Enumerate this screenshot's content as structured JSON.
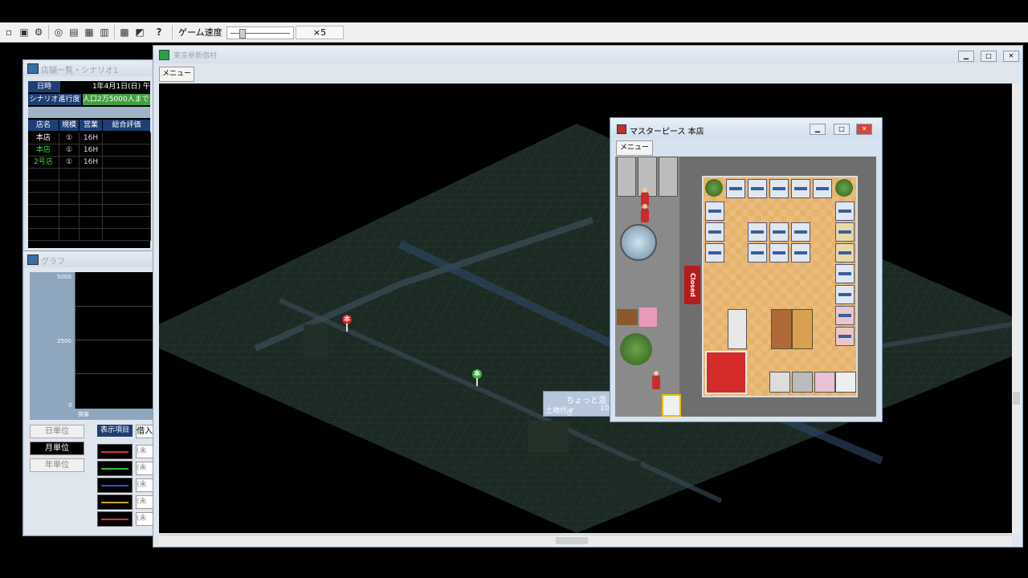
{
  "toolbar": {
    "icons": [
      "new-icon",
      "save-icon",
      "settings-icon",
      "search-icon",
      "print-icon",
      "list-icon",
      "book-icon",
      "chart-icon",
      "graph-icon",
      "help-icon"
    ],
    "help_label": "?",
    "speed_label": "ゲーム速度",
    "speed_value": "×5",
    "speed_level": 0.15
  },
  "store_list": {
    "title": "店舗一覧・シナリオ1",
    "date_label": "日時",
    "date_value": "1年4月1日(日) 午",
    "scenario_label": "シナリオ進行度",
    "scenario_value": "人口2万5000人まで",
    "columns": [
      "店名",
      "規模",
      "営業",
      "総合評価"
    ],
    "rows": [
      {
        "name": "本店",
        "size": "①",
        "hours": "16H",
        "color": "#ffffff"
      },
      {
        "name": "本店",
        "size": "①",
        "hours": "16H",
        "color": "#3fd23f"
      },
      {
        "name": "2号店",
        "size": "①",
        "hours": "16H",
        "color": "#3fd23f"
      }
    ]
  },
  "graph": {
    "title": "グラフ",
    "y_ticks": [
      "5000",
      "2500",
      "0"
    ],
    "x_label": "損害",
    "units": [
      "日単位",
      "月単位",
      "年単位"
    ],
    "active_unit": "月単位",
    "display_items_label": "表示項目",
    "display_item_value": "借入",
    "legend": [
      {
        "color": "#e03030",
        "label": "(未"
      },
      {
        "color": "#30c030",
        "label": "(未"
      },
      {
        "color": "#3050d0",
        "label": "(未"
      },
      {
        "color": "#d0a020",
        "label": "(未"
      },
      {
        "color": "#e03030",
        "label": "(未"
      }
    ]
  },
  "map_window": {
    "title": "東京県新宿村",
    "menu_label": "メニュー",
    "pins": [
      {
        "label": "本",
        "color": "#d81e1e"
      },
      {
        "label": "本",
        "color": "#2fae3a"
      }
    ],
    "tooltip": {
      "line1": "ちょっと混ぎ",
      "line2": "土地代",
      "line3": "10"
    }
  },
  "shop_window": {
    "title": "マスターピース 本店",
    "menu_label": "メニュー",
    "closed_sign": "Closed"
  }
}
